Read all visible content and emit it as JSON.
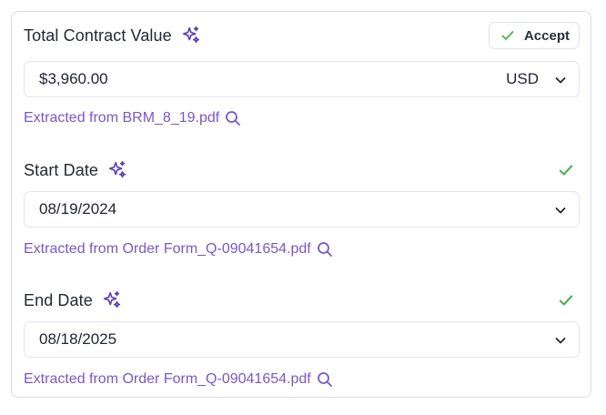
{
  "fields": [
    {
      "label": "Total Contract Value",
      "value": "$3,960.00",
      "currency": "USD",
      "source": "Extracted from BRM_8_19.pdf",
      "action": "Accept"
    },
    {
      "label": "Start Date",
      "value": "08/19/2024",
      "source": "Extracted from Order Form_Q-09041654.pdf",
      "status": "accepted"
    },
    {
      "label": "End Date",
      "value": "08/18/2025",
      "source": "Extracted from Order Form_Q-09041654.pdf",
      "status": "accepted"
    }
  ],
  "colors": {
    "accent": "#7758c9",
    "success": "#4caf50",
    "sparkle": "#5b3fb5",
    "border": "#e1e4ea"
  },
  "icons": {
    "sparkle": "sparkle-icon",
    "check": "check-icon",
    "chevron": "chevron-down-icon",
    "search": "search-icon"
  }
}
